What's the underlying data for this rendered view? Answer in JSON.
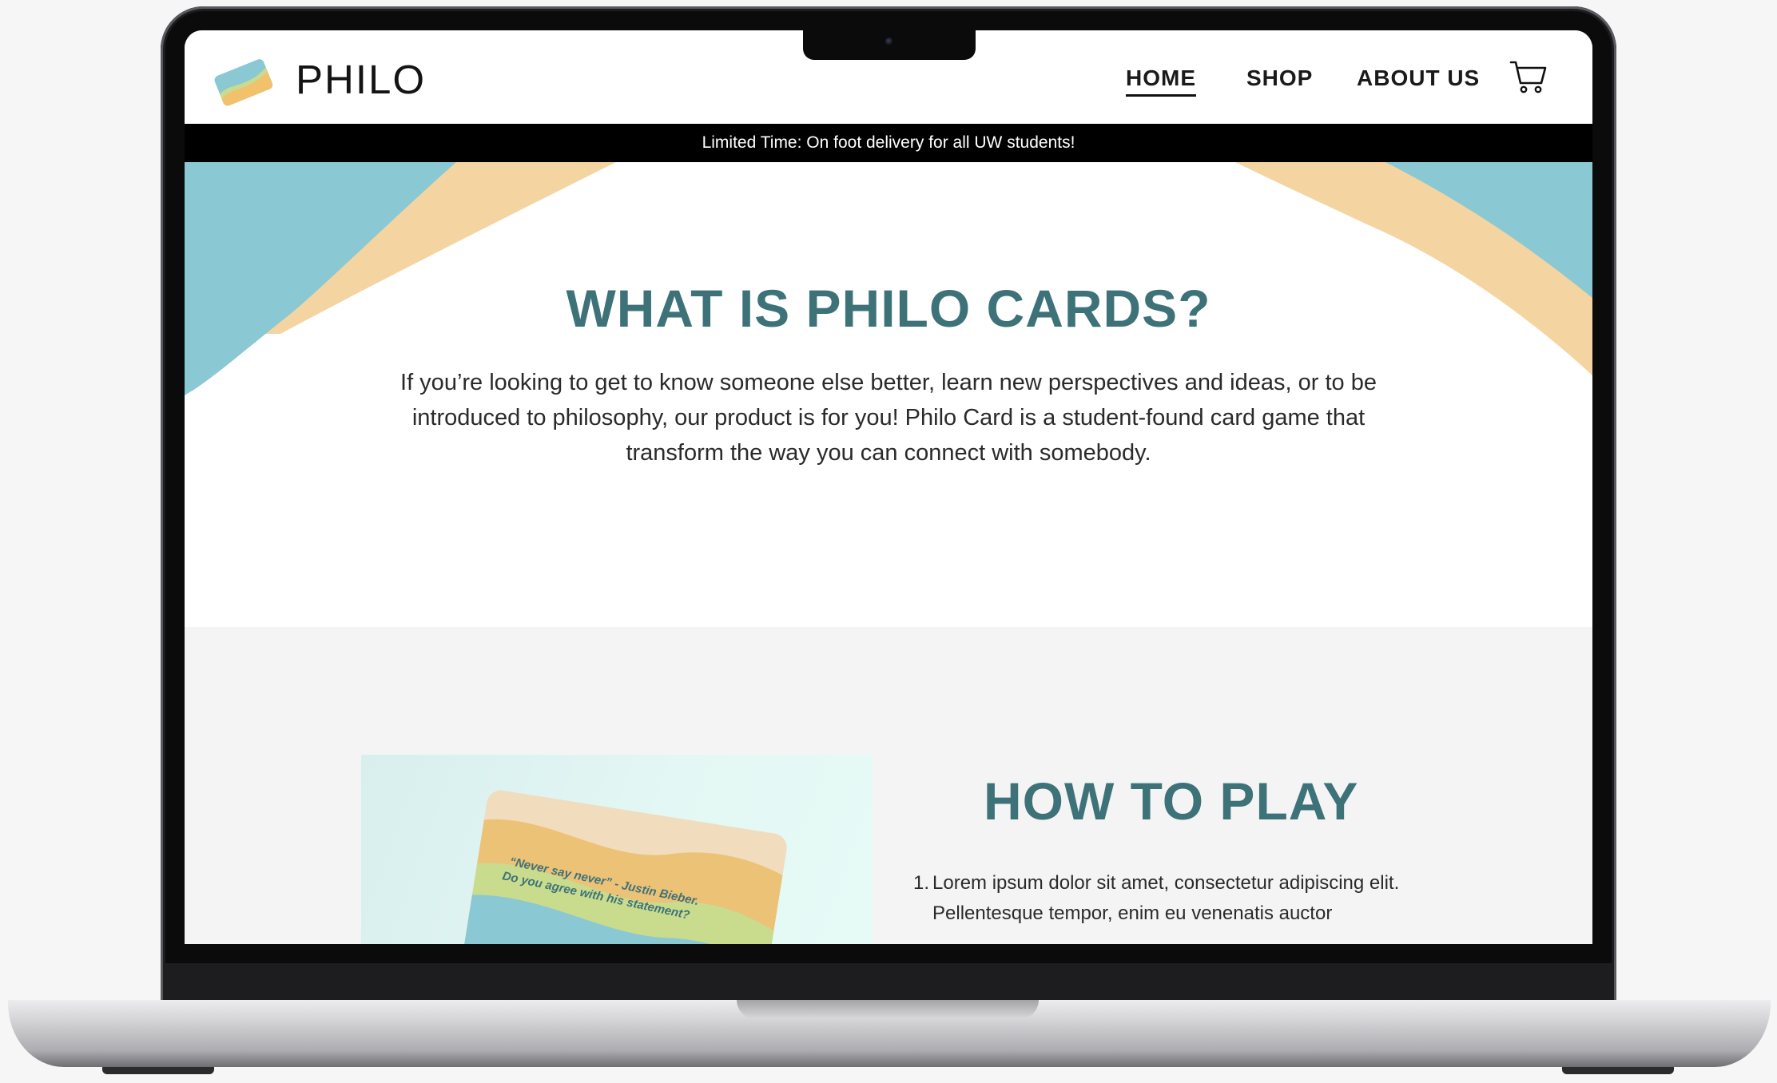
{
  "header": {
    "brand": "PHILO",
    "nav": {
      "home": "HOME",
      "shop": "SHOP",
      "about": "ABOUT US"
    }
  },
  "banner": {
    "text": "Limited Time: On foot delivery for all UW students!"
  },
  "hero": {
    "title": "WHAT IS PHILO CARDS?",
    "body": "If you’re looking to get to know someone else better, learn new perspectives and ideas, or to be introduced to philosophy, our product is for you! Philo Card is a student-found card game that transform the way you can connect with somebody."
  },
  "how_to_play": {
    "title": "HOW TO PLAY",
    "steps": [
      {
        "number": "1.",
        "text": "Lorem ipsum dolor sit amet, consectetur adipiscing elit. Pellentesque tempor, enim eu venenatis auctor"
      }
    ],
    "card": {
      "line1": "“Never say never” - Justin Bieber.",
      "line2": "Do you agree with his statement?"
    }
  },
  "icons": {
    "logo": "card-logo-icon",
    "cart": "shopping-cart-icon"
  },
  "colors": {
    "accent_teal": "#3e7279",
    "wave_blue": "#8ac8d3",
    "wave_sand": "#f4d5a2",
    "banner_bg": "#000000",
    "section_bg": "#f4f4f4"
  }
}
